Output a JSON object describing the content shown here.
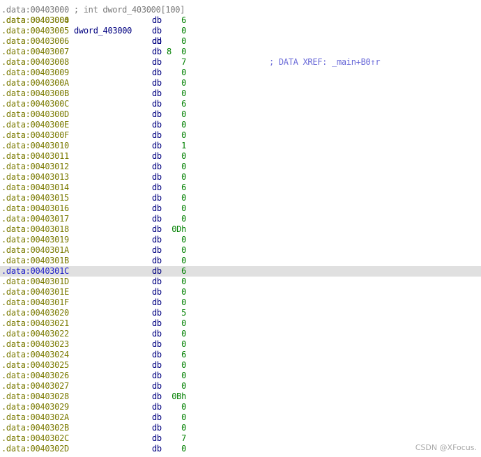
{
  "header_line": ".data:00403000 ; int dword_403000[100]",
  "first_line": {
    "address": ".data:00403000",
    "name": "dword_403000",
    "mnemonic": "dd",
    "value": "8",
    "comment": "; DATA XREF: _main+B0↑r"
  },
  "rows": [
    {
      "address": ".data:00403004",
      "mnemonic": "db",
      "value": "6"
    },
    {
      "address": ".data:00403005",
      "mnemonic": "db",
      "value": "0"
    },
    {
      "address": ".data:00403006",
      "mnemonic": "db",
      "value": "0"
    },
    {
      "address": ".data:00403007",
      "mnemonic": "db",
      "value": "0"
    },
    {
      "address": ".data:00403008",
      "mnemonic": "db",
      "value": "7"
    },
    {
      "address": ".data:00403009",
      "mnemonic": "db",
      "value": "0"
    },
    {
      "address": ".data:0040300A",
      "mnemonic": "db",
      "value": "0"
    },
    {
      "address": ".data:0040300B",
      "mnemonic": "db",
      "value": "0"
    },
    {
      "address": ".data:0040300C",
      "mnemonic": "db",
      "value": "6"
    },
    {
      "address": ".data:0040300D",
      "mnemonic": "db",
      "value": "0"
    },
    {
      "address": ".data:0040300E",
      "mnemonic": "db",
      "value": "0"
    },
    {
      "address": ".data:0040300F",
      "mnemonic": "db",
      "value": "0"
    },
    {
      "address": ".data:00403010",
      "mnemonic": "db",
      "value": "1"
    },
    {
      "address": ".data:00403011",
      "mnemonic": "db",
      "value": "0"
    },
    {
      "address": ".data:00403012",
      "mnemonic": "db",
      "value": "0"
    },
    {
      "address": ".data:00403013",
      "mnemonic": "db",
      "value": "0"
    },
    {
      "address": ".data:00403014",
      "mnemonic": "db",
      "value": "6"
    },
    {
      "address": ".data:00403015",
      "mnemonic": "db",
      "value": "0"
    },
    {
      "address": ".data:00403016",
      "mnemonic": "db",
      "value": "0"
    },
    {
      "address": ".data:00403017",
      "mnemonic": "db",
      "value": "0"
    },
    {
      "address": ".data:00403018",
      "mnemonic": "db",
      "value": "0Dh"
    },
    {
      "address": ".data:00403019",
      "mnemonic": "db",
      "value": "0"
    },
    {
      "address": ".data:0040301A",
      "mnemonic": "db",
      "value": "0"
    },
    {
      "address": ".data:0040301B",
      "mnemonic": "db",
      "value": "0"
    },
    {
      "address": ".data:0040301C",
      "mnemonic": "db",
      "value": "6",
      "selected": true
    },
    {
      "address": ".data:0040301D",
      "mnemonic": "db",
      "value": "0"
    },
    {
      "address": ".data:0040301E",
      "mnemonic": "db",
      "value": "0"
    },
    {
      "address": ".data:0040301F",
      "mnemonic": "db",
      "value": "0"
    },
    {
      "address": ".data:00403020",
      "mnemonic": "db",
      "value": "5"
    },
    {
      "address": ".data:00403021",
      "mnemonic": "db",
      "value": "0"
    },
    {
      "address": ".data:00403022",
      "mnemonic": "db",
      "value": "0"
    },
    {
      "address": ".data:00403023",
      "mnemonic": "db",
      "value": "0"
    },
    {
      "address": ".data:00403024",
      "mnemonic": "db",
      "value": "6"
    },
    {
      "address": ".data:00403025",
      "mnemonic": "db",
      "value": "0"
    },
    {
      "address": ".data:00403026",
      "mnemonic": "db",
      "value": "0"
    },
    {
      "address": ".data:00403027",
      "mnemonic": "db",
      "value": "0"
    },
    {
      "address": ".data:00403028",
      "mnemonic": "db",
      "value": "0Bh"
    },
    {
      "address": ".data:00403029",
      "mnemonic": "db",
      "value": "0"
    },
    {
      "address": ".data:0040302A",
      "mnemonic": "db",
      "value": "0"
    },
    {
      "address": ".data:0040302B",
      "mnemonic": "db",
      "value": "0"
    },
    {
      "address": ".data:0040302C",
      "mnemonic": "db",
      "value": "7"
    },
    {
      "address": ".data:0040302D",
      "mnemonic": "db",
      "value": "0"
    }
  ],
  "watermark": "CSDN @XFocus."
}
